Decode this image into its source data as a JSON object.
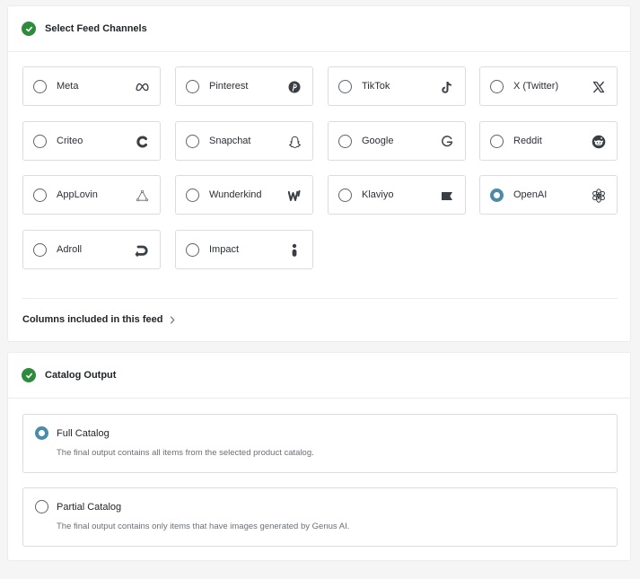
{
  "feed_channels": {
    "title": "Select Feed Channels",
    "channels": [
      {
        "label": "Meta",
        "icon": "meta-icon",
        "selected": false
      },
      {
        "label": "Pinterest",
        "icon": "pinterest-icon",
        "selected": false
      },
      {
        "label": "TikTok",
        "icon": "tiktok-icon",
        "selected": false
      },
      {
        "label": "X (Twitter)",
        "icon": "x-twitter-icon",
        "selected": false
      },
      {
        "label": "Criteo",
        "icon": "criteo-icon",
        "selected": false
      },
      {
        "label": "Snapchat",
        "icon": "snapchat-icon",
        "selected": false
      },
      {
        "label": "Google",
        "icon": "google-icon",
        "selected": false
      },
      {
        "label": "Reddit",
        "icon": "reddit-icon",
        "selected": false
      },
      {
        "label": "AppLovin",
        "icon": "applovin-icon",
        "selected": false
      },
      {
        "label": "Wunderkind",
        "icon": "wunderkind-icon",
        "selected": false
      },
      {
        "label": "Klaviyo",
        "icon": "klaviyo-icon",
        "selected": false
      },
      {
        "label": "OpenAI",
        "icon": "openai-icon",
        "selected": true
      },
      {
        "label": "Adroll",
        "icon": "adroll-icon",
        "selected": false
      },
      {
        "label": "Impact",
        "icon": "impact-icon",
        "selected": false
      }
    ],
    "columns_link": "Columns included in this feed"
  },
  "catalog_output": {
    "title": "Catalog Output",
    "options": [
      {
        "title": "Full Catalog",
        "description": "The final output contains all items from the selected product catalog.",
        "selected": true
      },
      {
        "title": "Partial Catalog",
        "description": "The final output contains only items that have images generated by Genus AI.",
        "selected": false
      }
    ]
  },
  "colors": {
    "check_green": "#2e8b3d",
    "radio_selected": "#4a8ca8",
    "border": "#dcdce0"
  }
}
